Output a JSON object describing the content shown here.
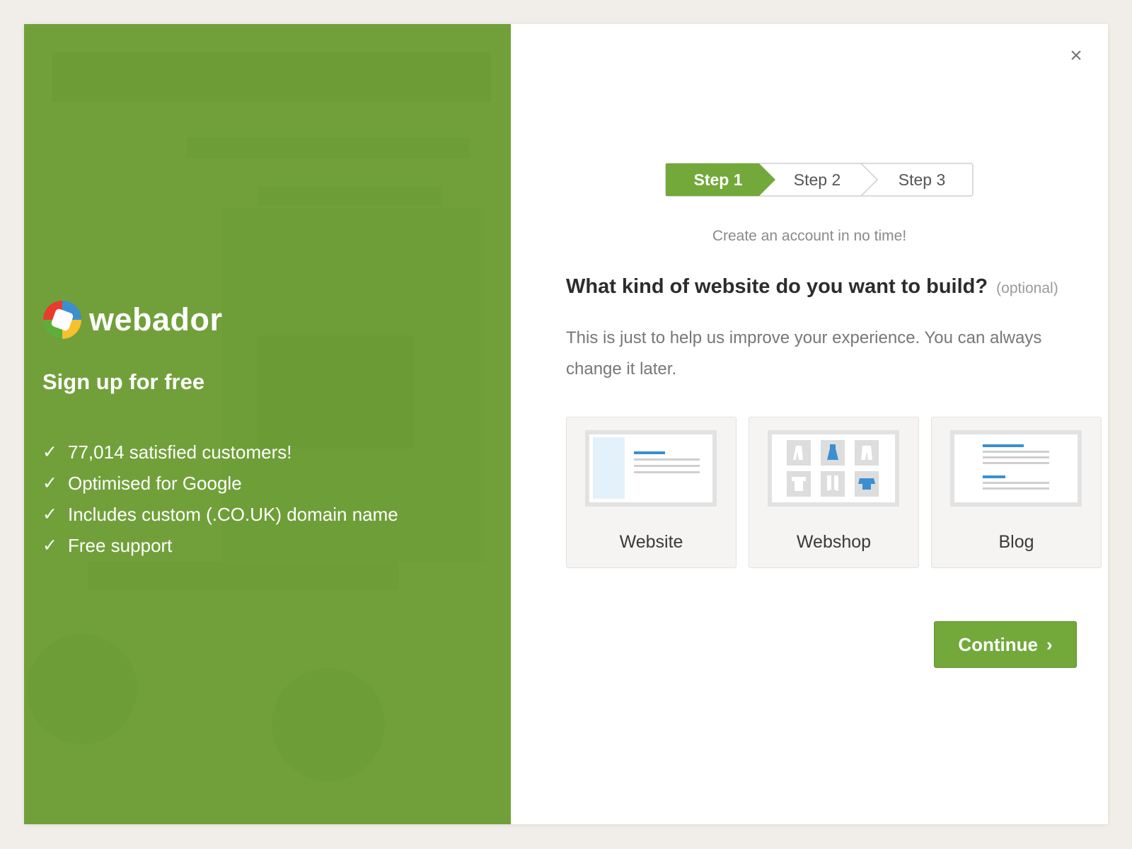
{
  "brand": {
    "name": "webador"
  },
  "left": {
    "tagline": "Sign up for free",
    "benefits": [
      "77,014 satisfied customers!",
      "Optimised for Google",
      "Includes custom (.CO.UK) domain name",
      "Free support"
    ],
    "check_icon": "✓"
  },
  "close_icon": "×",
  "steps": [
    {
      "label": "Step 1",
      "active": true
    },
    {
      "label": "Step 2",
      "active": false
    },
    {
      "label": "Step 3",
      "active": false
    }
  ],
  "subtitle": "Create an account in no time!",
  "question": {
    "text": "What kind of website do you want to build?",
    "optional": "(optional)"
  },
  "description": "This is just to help us improve your experience. You can always change it later.",
  "options": [
    {
      "label": "Website",
      "icon": "website-layout-icon"
    },
    {
      "label": "Webshop",
      "icon": "webshop-grid-icon"
    },
    {
      "label": "Blog",
      "icon": "blog-layout-icon"
    }
  ],
  "continue": {
    "label": "Continue",
    "icon": "›"
  },
  "colors": {
    "brand_green": "#71a03a",
    "button_green": "#72a93a",
    "accent_blue": "#3b8fd0"
  }
}
